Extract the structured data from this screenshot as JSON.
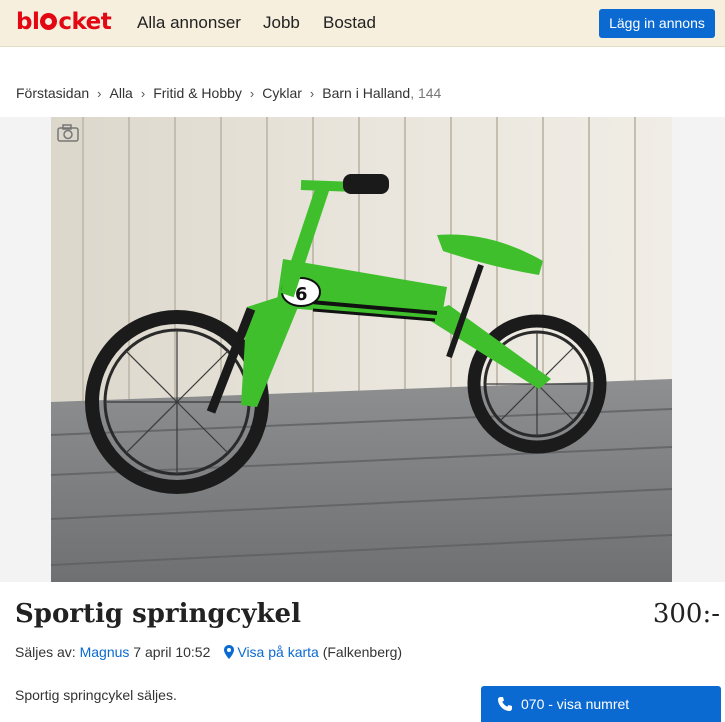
{
  "header": {
    "logo_part1": "bl",
    "logo_part2": "cket",
    "nav": {
      "all_ads": "Alla annonser",
      "jobs": "Jobb",
      "housing": "Bostad"
    },
    "post_ad": "Lägg in annons"
  },
  "breadcrumb": {
    "items": [
      "Förstasidan",
      "Alla",
      "Fritid & Hobby",
      "Cyklar",
      "Barn i Halland"
    ],
    "count": ", 144"
  },
  "photo": {
    "subject": "green balance bike",
    "camera_icon": "camera-icon"
  },
  "ad": {
    "title": "Sportig springcykel",
    "price": "300:-",
    "sold_by_label": "Säljes av:",
    "seller": "Magnus",
    "date": "7 april 10:52",
    "map_link": "Visa på karta",
    "location": "(Falkenberg)",
    "description": "Sportig springcykel säljes."
  },
  "contact": {
    "phone_label": "070 - visa numret",
    "icon": "phone-icon"
  },
  "colors": {
    "brand_blue": "#0a6ad1",
    "logo_red": "#e30613",
    "header_bg": "#f6efdd"
  }
}
